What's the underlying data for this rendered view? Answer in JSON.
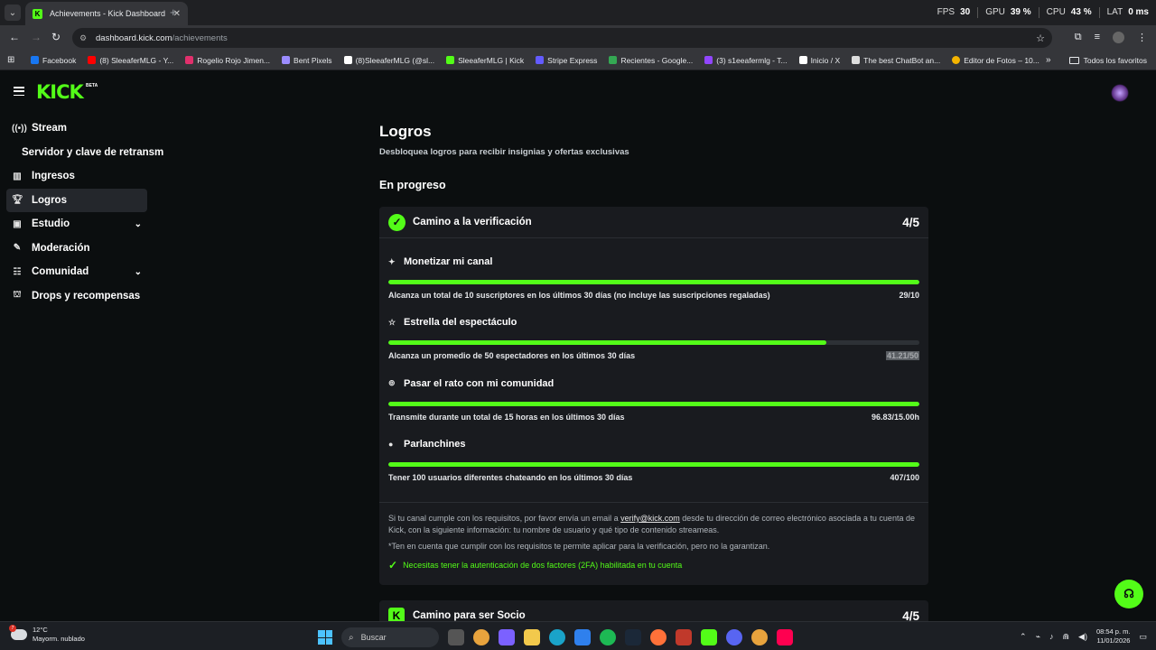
{
  "browser": {
    "tab_title": "Achievements - Kick Dashboard",
    "url_host": "dashboard.kick.com",
    "url_path": "/achievements",
    "perf": [
      {
        "label": "FPS",
        "value": "30"
      },
      {
        "label": "GPU",
        "value": "39 %"
      },
      {
        "label": "CPU",
        "value": "43 %"
      },
      {
        "label": "LAT",
        "value": "0 ms"
      }
    ],
    "bookmarks": [
      {
        "label": "Facebook",
        "color": "#1877f2"
      },
      {
        "label": "(8) SleeaferMLG - Y...",
        "color": "#ff0000"
      },
      {
        "label": "Rogelio Rojo Jimen...",
        "color": "#e1306c"
      },
      {
        "label": "Bent Pixels",
        "color": "#9b8cff"
      },
      {
        "label": "(8)SleeaferMLG (@sl...",
        "color": "#ffffff"
      },
      {
        "label": "SleeaferMLG | Kick",
        "color": "#53fc18"
      },
      {
        "label": "Stripe Express",
        "color": "#635bff"
      },
      {
        "label": "Recientes - Google...",
        "color": "#34a853"
      },
      {
        "label": "(3) s1eeafermlg - T...",
        "color": "#9146ff"
      },
      {
        "label": "Inicio / X",
        "color": "#ffffff"
      },
      {
        "label": "The best ChatBot an...",
        "color": "#dddddd"
      },
      {
        "label": "Editor de Fotos – 10...",
        "color": "#f4b400"
      }
    ],
    "bookmarks_all": "Todos los favoritos"
  },
  "brand": {
    "logo": "KICK",
    "beta": "BETA"
  },
  "sidebar": {
    "items": [
      {
        "label": "Stream",
        "icon": "broadcast-icon"
      },
      {
        "label": "Servidor y clave de retransm"
      },
      {
        "label": "Ingresos",
        "icon": "chart-icon"
      },
      {
        "label": "Logros",
        "icon": "trophy-icon"
      },
      {
        "label": "Estudio",
        "icon": "studio-icon"
      },
      {
        "label": "Moderación",
        "icon": "wrench-icon"
      },
      {
        "label": "Comunidad",
        "icon": "community-icon"
      },
      {
        "label": "Drops y recompensas",
        "icon": "gift-icon"
      }
    ]
  },
  "main": {
    "title": "Logros",
    "subtitle": "Desbloquea logros para recibir insignias y ofertas exclusivas",
    "section": "En progreso",
    "card1": {
      "title": "Camino a la verificación",
      "count": "4/5",
      "goals": [
        {
          "title": "Monetizar mi canal",
          "icon": "sparkle-icon",
          "desc": "Alcanza un total de 10 suscriptores en los últimos 30 días (no incluye las suscripciones regaladas)",
          "value": "29/10",
          "progress": 1.0
        },
        {
          "title": "Estrella del espectáculo",
          "icon": "star-person-icon",
          "desc": "Alcanza un promedio de 50 espectadores en los últimos 30 días",
          "value": "41.21/50",
          "progress": 0.8242
        },
        {
          "title": "Pasar el rato con mi comunidad",
          "icon": "broadcast-icon",
          "desc": "Transmite durante un total de 15 horas en los últimos 30 días",
          "value": "96.83/15.00h",
          "progress": 1.0
        },
        {
          "title": "Parlanchines",
          "icon": "chat-icon",
          "desc": "Tener 100 usuarios diferentes chateando en los últimos 30 días",
          "value": "407/100",
          "progress": 1.0
        }
      ],
      "footer_pre": "Si tu canal cumple con los requisitos, por favor envía un email a ",
      "footer_email": "verify@kick.com",
      "footer_post": " desde tu dirección de correo electrónico asociada a tu cuenta de Kick, con la siguiente información: tu nombre de usuario y qué tipo de contenido streameas.",
      "footer_note": "*Ten en cuenta que cumplir con los requisitos te permite aplicar para la verificación, pero no la garantizan.",
      "footer_2fa": "Necesitas tener la autenticación de dos factores (2FA) habilitada en tu cuenta"
    },
    "card2": {
      "title": "Camino para ser Socio",
      "count": "4/5"
    }
  },
  "taskbar": {
    "temp": "12°C",
    "weather": "Mayorm. nublado",
    "weather_badge": "7",
    "search_placeholder": "Buscar",
    "time": "08:54 p. m.",
    "date": "11/01/2026"
  }
}
